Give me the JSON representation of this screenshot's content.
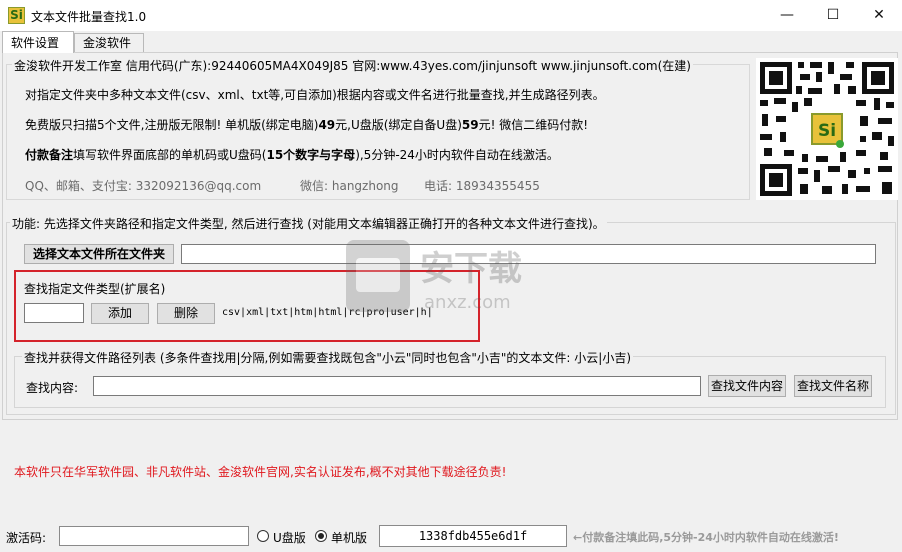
{
  "window": {
    "title": "文本文件批量查找1.0",
    "icon_text": "Si",
    "minimize_glyph": "—",
    "maximize_glyph": "☐",
    "close_glyph": "✕"
  },
  "tabs": [
    {
      "label": "软件设置"
    },
    {
      "label": "金浚软件"
    }
  ],
  "info": {
    "header": "金浚软件开发工作室 信用代码(广东):92440605MA4X049J85 官网:www.43yes.com/jinjunsoft  www.jinjunsoft.com(在建)",
    "line1": "对指定文件夹中多种文本文件(csv、xml、txt等,可自添加)根据内容或文件名进行批量查找,并生成路径列表。",
    "line2_pre": "免费版只扫描5个文件,注册版无限制! 单机版(绑定电脑)",
    "line2_price1": "49",
    "line2_mid": "元,U盘版(绑定自备U盘)",
    "line2_price2": "59",
    "line2_post": "元! 微信二维码付款!",
    "line3_bold": "付款备注",
    "line3_mid": "填写软件界面底部的单机码或U盘码(",
    "line3_bold2": "15个数字与字母",
    "line3_post": "),5分钟-24小时内软件自动在线激活。",
    "contact_qq": "QQ、邮箱、支付宝: 332092136@qq.com",
    "contact_wechat": "微信: hangzhong",
    "contact_phone": "电话: 18934355455"
  },
  "function": {
    "title": "功能: 先选择文件夹路径和指定文件类型, 然后进行查找 (对能用文本编辑器正确打开的各种文本文件进行查找)。",
    "select_folder_button": "选择文本文件所在文件夹",
    "folder_path_value": "",
    "ext_label": "查找指定文件类型(扩展名)",
    "ext_input_value": "",
    "add_button": "添加",
    "delete_button": "删除",
    "ext_list": "csv|xml|txt|htm|html|rc|pro|user|h|"
  },
  "search": {
    "title": "查找并获得文件路径列表 (多条件查找用|分隔,例如需要查找既包含\"小云\"同时也包含\"小吉\"的文本文件: 小云|小吉)",
    "content_label": "查找内容:",
    "content_value": "",
    "find_content_button": "查找文件内容",
    "find_name_button": "查找文件名称"
  },
  "notice": "本软件只在华军软件园、非凡软件站、金浚软件官网,实名认证发布,概不对其他下载途径负责!",
  "status": {
    "activation_label": "激活码:",
    "activation_value": "",
    "usb_option": "U盘版",
    "pc_option": "单机版",
    "selected": "pc",
    "machine_code": "1338fdb455e6d1f",
    "hint": "←付款备注填此码,5分钟-24小时内软件自动在线激活!"
  },
  "watermark": {
    "text": "安下载",
    "subtext": "anxz.com"
  },
  "colors": {
    "accent_red": "#d4232b",
    "notice_red": "#e0181e",
    "hint_gray": "#9a9a9a"
  }
}
